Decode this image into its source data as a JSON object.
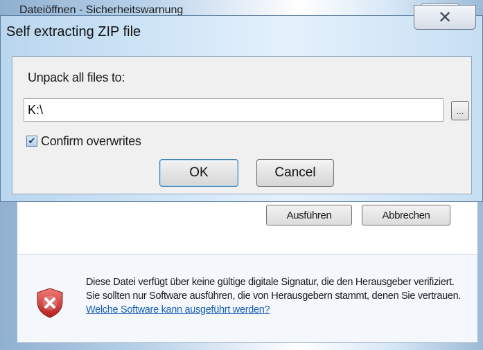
{
  "background_dialog": {
    "title": "Dateiöffnen - Sicherheitswarnung",
    "buttons": {
      "run": "Ausführen",
      "cancel": "Abbrechen"
    },
    "warning": {
      "text": "Diese Datei verfügt über keine gültige digitale Signatur, die den Herausgeber verifiziert. Sie sollten nur Software ausführen, die von Herausgebern stammt, denen Sie vertrauen. ",
      "link": "Welche Software kann ausgeführt werden?",
      "icon": "shield-error-icon"
    }
  },
  "zip_dialog": {
    "title": "Self extracting ZIP file",
    "close_glyph": "✕",
    "unpack_label": "Unpack all files to:",
    "path_value": "K:\\",
    "browse_label": "...",
    "confirm_overwrites": {
      "label": "Confirm overwrites",
      "checked": true
    },
    "ok_label": "OK",
    "cancel_label": "Cancel"
  },
  "colors": {
    "link": "#1a5fb4",
    "shield_red": "#d9322e"
  }
}
